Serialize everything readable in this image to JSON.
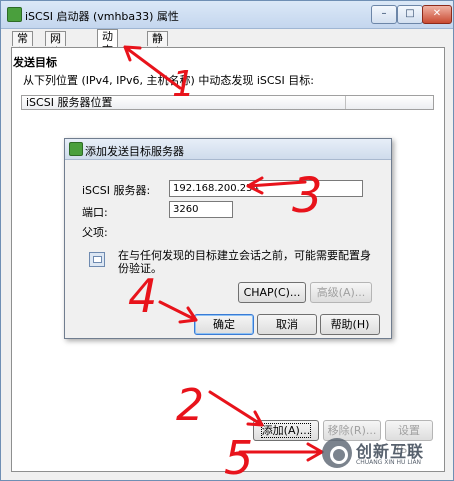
{
  "window": {
    "title": "iSCSI 启动器 (vmhba33) 属性",
    "controls": {
      "minimize": "–",
      "maximize": "□",
      "close": "✕"
    }
  },
  "tabs": [
    {
      "label": "常规"
    },
    {
      "label": "网络配置"
    },
    {
      "label": "动态发现",
      "active": true
    },
    {
      "label": "静态发现"
    }
  ],
  "dynamic_discovery": {
    "section_title": "发送目标",
    "description": "从下列位置 (IPv4, IPv6, 主机名称) 中动态发现 iSCSI 目标:",
    "list_header": "iSCSI 服务器位置",
    "buttons": {
      "add": "添加(A)...",
      "remove": "移除(R)...",
      "settings": "设置(S)..."
    }
  },
  "dialog": {
    "title": "添加发送目标服务器",
    "server_label": "iSCSI 服务器:",
    "server_value": "192.168.200.254",
    "port_label": "端口:",
    "port_value": "3260",
    "parent_label": "父项:",
    "note": "在与任何发现的目标建立会话之前，可能需要配置身份验证。",
    "buttons": {
      "chap": "CHAP(C)...",
      "advanced": "高级(A)...",
      "ok": "确定",
      "cancel": "取消",
      "help": "帮助(H)"
    }
  },
  "annotations": {
    "n1": "1",
    "n2": "2",
    "n3": "3",
    "n4": "4",
    "n5": "5"
  },
  "annotation_color": "#e8131b",
  "watermark": {
    "brand": "创新互联",
    "sub": "CHUANG XIN HU LIAN"
  }
}
